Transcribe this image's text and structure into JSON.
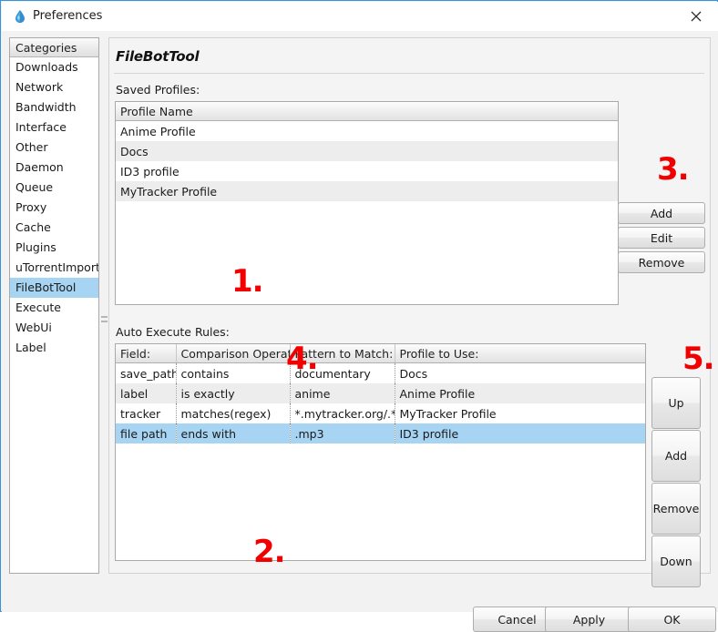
{
  "window": {
    "title": "Preferences",
    "icon": "water-drop-icon",
    "close_label": "×",
    "border_color": "#3a93d4"
  },
  "sidebar": {
    "header": "Categories",
    "selected": "FileBotTool",
    "items": [
      {
        "label": "Downloads"
      },
      {
        "label": "Network"
      },
      {
        "label": "Bandwidth"
      },
      {
        "label": "Interface"
      },
      {
        "label": "Other"
      },
      {
        "label": "Daemon"
      },
      {
        "label": "Queue"
      },
      {
        "label": "Proxy"
      },
      {
        "label": "Cache"
      },
      {
        "label": "Plugins"
      },
      {
        "label": "uTorrentImport"
      },
      {
        "label": "FileBotTool"
      },
      {
        "label": "Execute"
      },
      {
        "label": "WebUi"
      },
      {
        "label": "Label"
      }
    ]
  },
  "main": {
    "panel_title": "FileBotTool",
    "profiles_label": "Saved Profiles:",
    "rules_label": "Auto Execute Rules:"
  },
  "profiles_table": {
    "columns": [
      "Profile Name"
    ],
    "rows": [
      [
        "Anime Profile"
      ],
      [
        "Docs"
      ],
      [
        "ID3 profile"
      ],
      [
        "MyTracker Profile"
      ]
    ],
    "selected_row_index": -1
  },
  "rules_table": {
    "columns": [
      "Field:",
      "Comparison Operator:",
      "Pattern to Match:",
      "Profile to Use:"
    ],
    "rows": [
      [
        "save_path",
        "contains",
        "documentary",
        "Docs"
      ],
      [
        "label",
        "is exactly",
        "anime",
        "Anime Profile"
      ],
      [
        "tracker",
        "matches(regex)",
        "*.mytracker.org/.*",
        "MyTracker Profile"
      ],
      [
        "file path",
        "ends with",
        ".mp3",
        "ID3 profile"
      ]
    ],
    "selected_row_index": 3,
    "selection_color": "#a7d4f2"
  },
  "profile_buttons": {
    "add": "Add",
    "edit": "Edit",
    "remove": "Remove"
  },
  "rule_buttons": {
    "up": "Up",
    "add": "Add",
    "remove": "Remove",
    "down": "Down"
  },
  "dialog_buttons": {
    "cancel": "Cancel",
    "apply": "Apply",
    "ok": "OK"
  },
  "annotations": {
    "color": "#f20000",
    "one": "1.",
    "two": "2.",
    "three": "3.",
    "four": "4.",
    "five": "5."
  }
}
